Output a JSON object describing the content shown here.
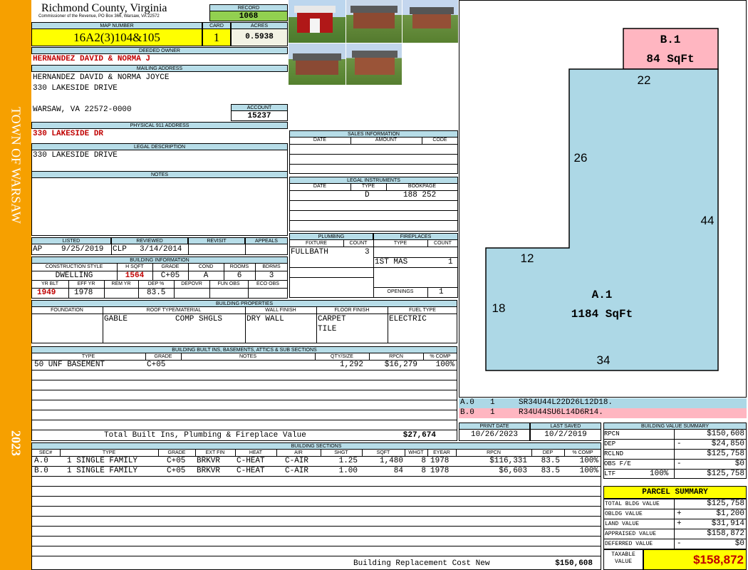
{
  "side": {
    "town": "TOWN OF WARSAW",
    "year": "2023"
  },
  "header": {
    "county": "Richmond County, Virginia",
    "commissioner": "Commissioner of the Revenue, PO Box 366, Warsaw, VA 22572",
    "record_label": "RECORD",
    "record": "1068",
    "map_label": "MAP NUMBER",
    "map": "16A2(3)104&105",
    "card_label": "CARD",
    "card": "1",
    "acres_label": "ACRES",
    "acres": "0.5938"
  },
  "owner": {
    "deeded_label": "DEEDED OWNER",
    "deeded": "HERNANDEZ DAVID & NORMA J",
    "mailing_label": "MAILING ADDRESS",
    "line1": "HERNANDEZ DAVID & NORMA JOYCE",
    "line2": "330 LAKESIDE DRIVE",
    "line3": "WARSAW, VA 22572-0000",
    "account_label": "ACCOUNT",
    "account": "15237"
  },
  "physical": {
    "label": "PHYSICAL 911 ADDRESS",
    "value": "330 LAKESIDE DR"
  },
  "legal": {
    "label": "LEGAL DESCRIPTION",
    "value": "330 LAKESIDE DRIVE"
  },
  "notes": {
    "label": "NOTES"
  },
  "listed": {
    "listed_label": "LISTED",
    "listed_by": "AP",
    "listed_date": "9/25/2019",
    "reviewed_label": "REVIEWED",
    "reviewed_by": "CLP",
    "reviewed_date": "3/14/2014",
    "revisit_label": "REVISIT",
    "appeals_label": "APPEALS"
  },
  "building_info": {
    "label": "BUILDING INFORMATION",
    "h": [
      "CONSTRUCTION STYLE",
      "H SQFT",
      "GRADE",
      "COND",
      "ROOMS",
      "BDRMS"
    ],
    "v": [
      "DWELLING",
      "1564",
      "C+05",
      "A",
      "6",
      "3"
    ],
    "h2": [
      "YR BLT",
      "EFF YR",
      "REM YR",
      "DEP %",
      "DEPOVR",
      "FUN OBS",
      "ECO OBS"
    ],
    "v2": [
      "1949",
      "1978",
      "",
      "83.5",
      "",
      "",
      ""
    ]
  },
  "sales": {
    "label": "SALES INFORMATION",
    "h": [
      "DATE",
      "AMOUNT",
      "CODE"
    ]
  },
  "legal_instruments": {
    "label": "LEGAL INSTRUMENTS",
    "h": [
      "DATE",
      "TYPE",
      "BOOKPAGE"
    ],
    "type": "D",
    "book": "188 252"
  },
  "plumbing": {
    "label": "PLUMBING",
    "h": [
      "FIXTURE",
      "COUNT"
    ],
    "fixture": "FULLBATH",
    "count": "3"
  },
  "fireplaces": {
    "label": "FIREPLACES",
    "h": [
      "TYPE",
      "COUNT"
    ],
    "type": "1ST MAS",
    "count": "1",
    "openings_label": "OPENINGS",
    "openings": "1"
  },
  "properties": {
    "label": "BUILDING PROPERTIES",
    "h": [
      "FOUNDATION",
      "ROOF TYPE/MATERIAL",
      "WALL FINISH",
      "FLOOR FINISH",
      "FUEL TYPE"
    ],
    "roof_type": "GABLE",
    "roof_material": "COMP SHGLS",
    "wall": "DRY WALL",
    "floor1": "CARPET",
    "floor2": "TILE",
    "fuel": "ELECTRIC"
  },
  "builtins": {
    "label": "BUILDING BUILT INS, BASEMENTS, ATTICS & SUB SECTIONS",
    "h": [
      "TYPE",
      "GRADE",
      "NOTES",
      "QTY/SIZE",
      "RPCN",
      "% COMP"
    ],
    "rows": [
      {
        "type": "50 UNF BASEMENT",
        "grade": "C+05",
        "notes": "",
        "qty": "1,292",
        "rpcn": "$16,279",
        "comp": "100%"
      }
    ],
    "total_label": "Total Built Ins, Plumbing & Fireplace Value",
    "total": "$27,674"
  },
  "sections": {
    "label": "BUILDING SECTIONS",
    "h": [
      "SEC#",
      "TYPE",
      "GRADE",
      "EXT FIN",
      "HEAT",
      "AIR",
      "SHGT",
      "SQFT",
      "WHGT",
      "EYEAR",
      "RPCN",
      "DEP",
      "% COMP"
    ],
    "rows": [
      {
        "sec": "A.0",
        "type": "1 SINGLE FAMILY",
        "grade": "C+05",
        "ext": "BRKVR",
        "heat": "C-HEAT",
        "air": "C-AIR",
        "shgt": "1.25",
        "sqft": "1,480",
        "whgt": "8",
        "eyear": "1978",
        "rpcn": "$116,331",
        "dep": "83.5",
        "comp": "100%"
      },
      {
        "sec": "B.0",
        "type": "1 SINGLE FAMILY",
        "grade": "C+05",
        "ext": "BRKVR",
        "heat": "C-HEAT",
        "air": "C-AIR",
        "shgt": "1.00",
        "sqft": "84",
        "whgt": "8",
        "eyear": "1978",
        "rpcn": "$6,603",
        "dep": "83.5",
        "comp": "100%"
      }
    ],
    "brcn_label": "Building Replacement Cost New",
    "brcn": "$150,608"
  },
  "sketch": {
    "b_label": "B.1",
    "b_area": "84 SqFt",
    "a_label": "A.1",
    "a_area": "1184 SqFt",
    "dims": [
      "22",
      "26",
      "44",
      "12",
      "18",
      "34"
    ],
    "codes": [
      {
        "sec": "A.0",
        "n": "1",
        "code": "SR34U44L22D26L12D18."
      },
      {
        "sec": "B.0",
        "n": "1",
        "code": "R34U44SU6L14D6R14."
      }
    ],
    "colors": {
      "a": "#add8e6",
      "b": "#ffb6c1"
    }
  },
  "dates": {
    "print_label": "PRINT DATE",
    "print": "10/26/2023",
    "saved_label": "LAST SAVED",
    "saved": "10/2/2019"
  },
  "bvs": {
    "label": "BUILDING VALUE SUMMARY",
    "rows": [
      {
        "k": "RPCN",
        "op": "",
        "pct": "",
        "v": "$150,608"
      },
      {
        "k": "DEP",
        "op": "-",
        "pct": "",
        "v": "$24,850"
      },
      {
        "k": "RCLND",
        "op": "",
        "pct": "",
        "v": "$125,758"
      },
      {
        "k": "OBS F/E",
        "op": "-",
        "pct": "",
        "v": "$0"
      },
      {
        "k": "LTF",
        "op": "",
        "pct": "100%",
        "v": "$125,758"
      }
    ]
  },
  "parcel": {
    "label": "PARCEL SUMMARY",
    "rows": [
      {
        "k": "TOTAL BLDG VALUE",
        "op": "",
        "v": "$125,758"
      },
      {
        "k": "OBLDG VALUE",
        "op": "+",
        "v": "$1,200"
      },
      {
        "k": "LAND VALUE",
        "op": "+",
        "v": "$31,914"
      },
      {
        "k": "APPRAISED VALUE",
        "op": "",
        "v": "$158,872"
      },
      {
        "k": "DEFERRED VALUE",
        "op": "-",
        "v": "$0"
      }
    ],
    "taxable_label1": "TAXABLE",
    "taxable_label2": "VALUE",
    "taxable": "$158,872"
  }
}
